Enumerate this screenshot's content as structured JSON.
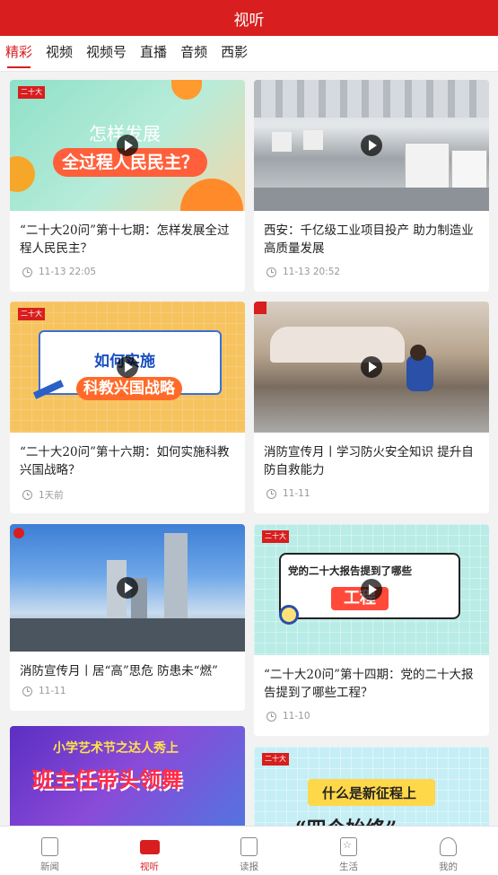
{
  "header": {
    "title": "视听"
  },
  "tabs": [
    "精彩",
    "视频",
    "视频号",
    "直播",
    "音频",
    "西影"
  ],
  "cards": [
    {
      "title": "“二十大20问”第十七期：怎样发展全过程人民民主？",
      "time": "11-13 22:05",
      "overlay_1": "怎样发展",
      "overlay_2": "全过程人民民主？",
      "logo": "二十大"
    },
    {
      "title": "西安：千亿级工业项目投产 助力制造业高质量发展",
      "time": "11-13 20:52"
    },
    {
      "title": "“二十大20问”第十六期：如何实施科教兴国战略？",
      "time": "1天前",
      "overlay_1": "如何实施",
      "overlay_2": "科教兴国战略",
      "logo": "二十大"
    },
    {
      "title": "消防宣传月丨学习防火安全知识 提升自防自救能力",
      "time": "11-11"
    },
    {
      "title": "消防宣传月丨居“高”思危 防患未“燃”",
      "time": "11-11"
    },
    {
      "title": "“二十大20问”第十四期：党的二十大报告提到了哪些工程？",
      "time": "11-10",
      "overlay_1": "党的二十大报告提到了哪些",
      "overlay_2": "工程",
      "logo": "二十大"
    },
    {
      "overlay_1": "小学艺术节之达人秀上",
      "overlay_2": "班主任带头领舞"
    },
    {
      "overlay_1": "什么是新征程上",
      "overlay_2": "“四个始终”",
      "logo": "二十大"
    }
  ],
  "bottom_nav": [
    {
      "label": "新闻",
      "icon": "news-icon"
    },
    {
      "label": "视听",
      "icon": "video-icon"
    },
    {
      "label": "读报",
      "icon": "newspaper-icon"
    },
    {
      "label": "生活",
      "icon": "life-icon"
    },
    {
      "label": "我的",
      "icon": "profile-icon"
    }
  ],
  "colors": {
    "brand": "#d81e1e"
  }
}
